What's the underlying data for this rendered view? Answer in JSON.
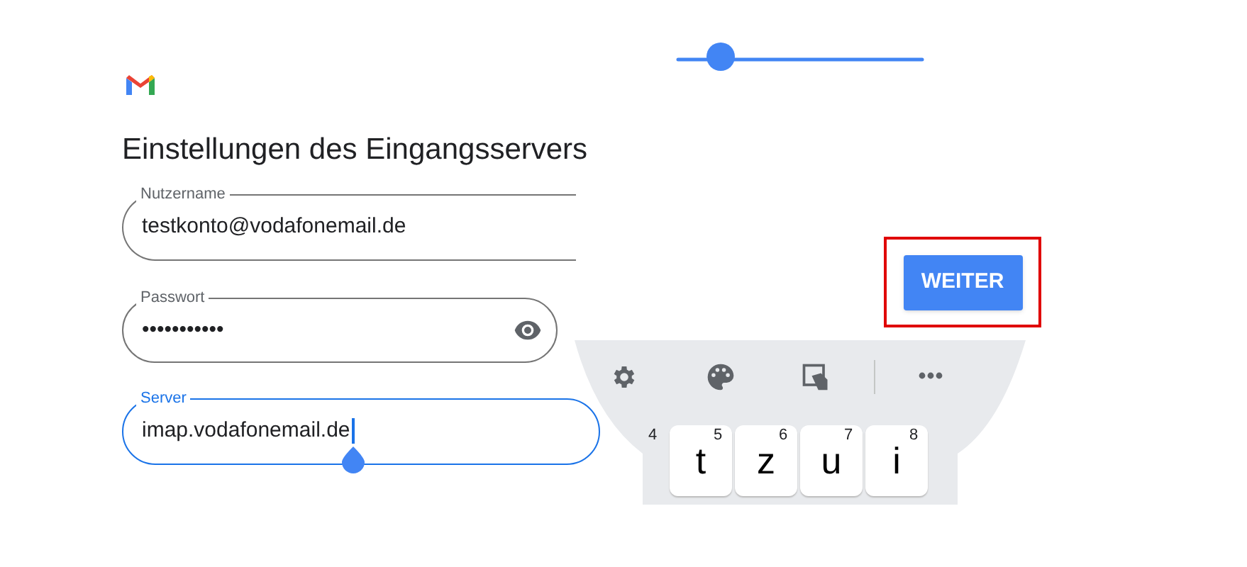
{
  "title": "Einstellungen des Eingangsservers",
  "fields": [
    {
      "kind": "text",
      "label": "Nutzername",
      "value": "testkonto@vodafonemail.de",
      "focused": false
    },
    {
      "kind": "password",
      "label": "Passwort",
      "value": "•••••••••••",
      "focused": false
    },
    {
      "kind": "text",
      "label": "Server",
      "value": "imap.vodafonemail.de",
      "focused": true
    }
  ],
  "button": "WEITER",
  "keys": [
    {
      "hint": "4"
    },
    {
      "hint": "5",
      "letter": "t"
    },
    {
      "hint": "6",
      "letter": "z"
    },
    {
      "hint": "7",
      "letter": "u"
    },
    {
      "hint": "8",
      "letter": "i"
    }
  ]
}
